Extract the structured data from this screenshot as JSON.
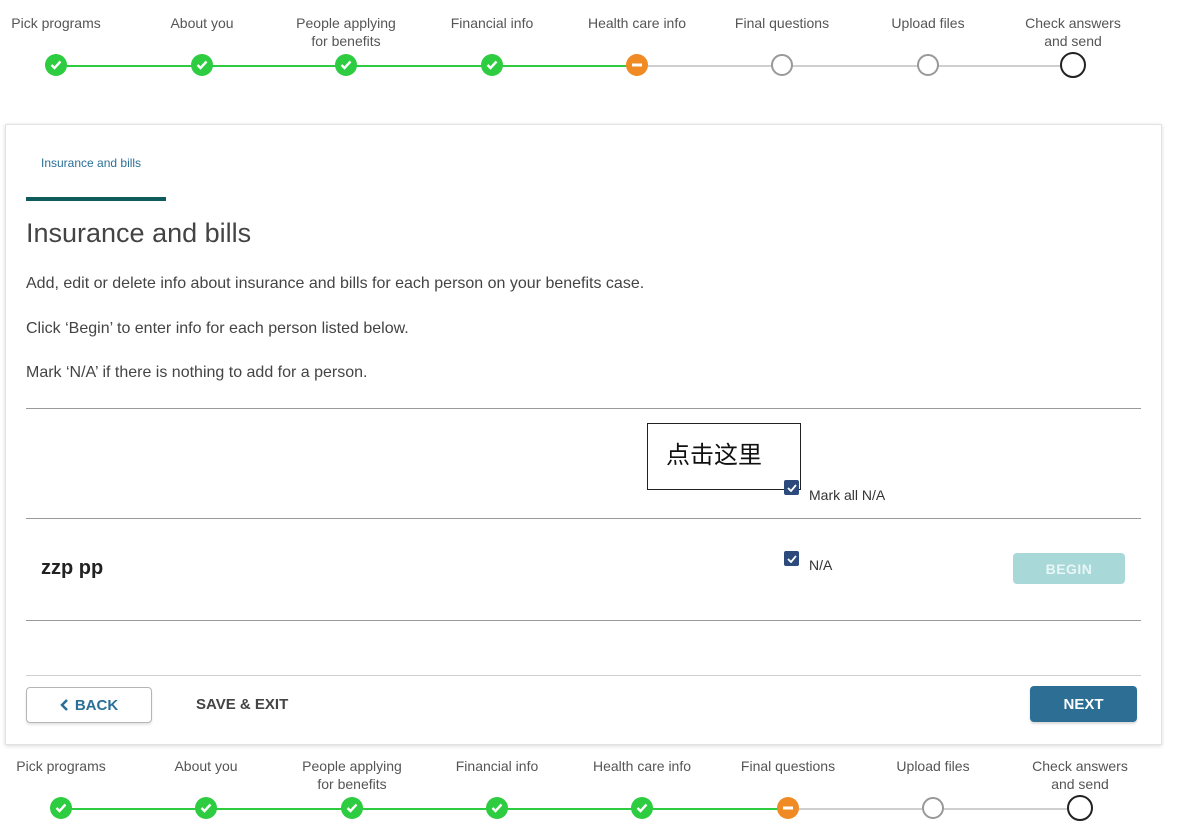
{
  "stepper_steps": [
    {
      "label_line1": "Pick programs",
      "label_line2": "",
      "state": "done"
    },
    {
      "label_line1": "About you",
      "label_line2": "",
      "state": "done"
    },
    {
      "label_line1": "People applying",
      "label_line2": "for benefits",
      "state": "done"
    },
    {
      "label_line1": "Financial info",
      "label_line2": "",
      "state": "done"
    },
    {
      "label_line1": "Health care info",
      "label_line2": "",
      "state": "current"
    },
    {
      "label_line1": "Final questions",
      "label_line2": "",
      "state": "todo"
    },
    {
      "label_line1": "Upload files",
      "label_line2": "",
      "state": "todo"
    },
    {
      "label_line1": "Check answers",
      "label_line2": "and send",
      "state": "last"
    }
  ],
  "bottom_stepper_steps": [
    {
      "label_line1": "Pick programs",
      "label_line2": "",
      "state": "done"
    },
    {
      "label_line1": "About you",
      "label_line2": "",
      "state": "done"
    },
    {
      "label_line1": "People applying",
      "label_line2": "for benefits",
      "state": "done"
    },
    {
      "label_line1": "Financial info",
      "label_line2": "",
      "state": "done"
    },
    {
      "label_line1": "Health care info",
      "label_line2": "",
      "state": "done"
    },
    {
      "label_line1": "Final questions",
      "label_line2": "",
      "state": "current"
    },
    {
      "label_line1": "Upload files",
      "label_line2": "",
      "state": "todo"
    },
    {
      "label_line1": "Check answers",
      "label_line2": "and send",
      "state": "last"
    }
  ],
  "colors": {
    "done": "#2ecc40",
    "current": "#f08a24",
    "accent": "#0e5c5c",
    "primary_button": "#2d6e95"
  },
  "page": {
    "breadcrumb": "Insurance and bills",
    "title": "Insurance and bills",
    "paragraph1": "Add, edit or delete info about insurance and bills for each person on your benefits case.",
    "paragraph2": "Click ‘Begin’ to enter info for each person listed below.",
    "paragraph3": "Mark ‘N/A’ if there is nothing to add for a person."
  },
  "annotation_text": "点击这里",
  "mark_all": {
    "label": "Mark all N/A",
    "checked": true
  },
  "people": [
    {
      "name": "zzp pp",
      "na_label": "N/A",
      "na_checked": true,
      "begin_label": "BEGIN"
    }
  ],
  "nav": {
    "back_label": "BACK",
    "save_exit_label": "SAVE & EXIT",
    "next_label": "NEXT"
  }
}
